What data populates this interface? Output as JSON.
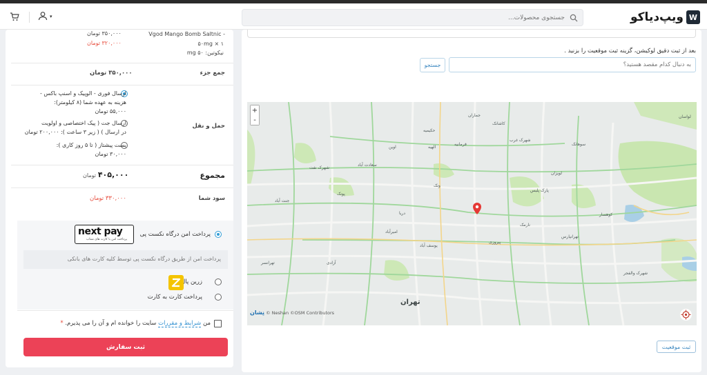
{
  "header": {
    "logo_letter": "W",
    "logo_text": "ویپ‌دیاکو",
    "search_placeholder": "جستجوی محصولات..."
  },
  "order": {
    "product_name_line1": "Vgod Mango Bomb Saltnic -",
    "product_name_line2": "۵۰mg × ۱",
    "product_name_line3": "نیکوتین: ۵۰ mg",
    "product_price_old": "۳۵۰,۰۰۰ تومان",
    "product_price_new": "۳۲۰,۰۰۰ تومان",
    "subtotal_label": "جمع جزء",
    "subtotal_value": "۳۵۰,۰۰۰ تومان",
    "shipping_label": "حمل و نقل",
    "shipping_options": [
      {
        "line1": "ارسال فوری - الوپیک و اسنپ باکس -",
        "line2": "هزینه به عهده شما (۸ کیلومتر):",
        "line3": "۵۵,۰۰۰ تومان"
      },
      {
        "line1": "ارسال جت ( پیک اختصاصی و اولویت",
        "line2": "در ارسال ) ( زیر ۳ ساعت ): ۲۰۰,۰۰۰ تومان"
      },
      {
        "line1": "پست پیشتاز ( تا ۵ روز کاری ):",
        "line2": "۳۰,۰۰۰ تومان"
      }
    ],
    "total_label": "مجموع",
    "total_amount": "۴۰۵,۰۰۰",
    "total_currency": "تومان",
    "profit_label": "سود شما",
    "profit_value": "۳۳۰,۰۰۰ تومان"
  },
  "payment": {
    "nextpay_label": "پرداخت امن درگاه نکست پی",
    "nextpay_logo_text": "next pay",
    "nextpay_logo_sub": "پرداخت امن با کارت های شتاب",
    "nextpay_note": "پرداخت امن از طریق درگاه نکست پی توسط کلیه کارت های بانکی",
    "zarinpal_label": "زرین پال",
    "card_label": "پرداخت کارت به کارت",
    "terms_prefix": "من",
    "terms_link": "شرایط و مقررات",
    "terms_suffix": "سایت را خوانده ام و آن را می پذیرم.",
    "terms_required": "*",
    "submit_label": "ثبت سفارش"
  },
  "map_section": {
    "help_text": "بعد از ثبت دقیق لوکیشن، گزینه ثبت موقعیت را بزنید .",
    "search_placeholder": "به دنبال کدام مقصد هستید؟",
    "search_button": "جستجو",
    "zoom_in": "+",
    "zoom_out": "-",
    "attribution_logo": "نِشان",
    "attribution": "© Neshan ©OSM Contributors",
    "city_label": "تهران",
    "submit_location": "ثبت موقعیت",
    "places": [
      "لواسان",
      "سوهانک",
      "شهرک غرب",
      "کاشانک",
      "جماران",
      "ونک",
      "سعادت آباد",
      "پونک",
      "جنت آباد",
      "شهرک نفت",
      "دریا",
      "لویزان",
      "پارک پلیس",
      "کوهسار",
      "تهرانپارس",
      "نارمک",
      "پیروزی",
      "تهرانسر",
      "شهرک والفجر",
      "آزادی",
      "یوسف آباد",
      "امیرآباد",
      "فرمانیه",
      "حکیمیه",
      "اوین",
      "الهیه"
    ]
  }
}
